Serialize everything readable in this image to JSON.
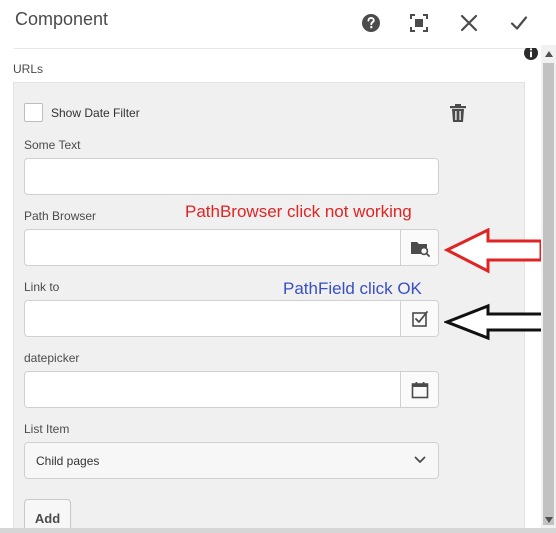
{
  "dialog": {
    "title": "Component",
    "help_tooltip": "Help",
    "fullscreen_tooltip": "Toggle Fullscreen",
    "cancel_tooltip": "Cancel",
    "done_tooltip": "Done"
  },
  "section": {
    "label": "URLs"
  },
  "item": {
    "checkbox_label": "Show Date Filter",
    "checkbox_checked": false,
    "fields": {
      "some_text": {
        "label": "Some Text",
        "value": ""
      },
      "path_browser": {
        "label": "Path Browser",
        "value": ""
      },
      "link_to": {
        "label": "Link to",
        "value": ""
      },
      "datepicker": {
        "label": "datepicker",
        "value": ""
      },
      "list_item": {
        "label": "List Item",
        "value": "Child pages"
      }
    }
  },
  "add_button": {
    "label": "Add"
  },
  "annotations": {
    "red": {
      "text": "PathBrowser click not working",
      "color": "#e02424"
    },
    "blue": {
      "text": "PathField click OK",
      "color": "#3a4fc2"
    }
  },
  "icons": {
    "help": "help-circle-icon",
    "fullscreen": "fullscreen-icon",
    "close": "close-icon",
    "done": "checkmark-icon",
    "info": "info-icon",
    "delete": "trash-icon",
    "path_browser": "folder-search-icon",
    "path_field": "checkbox-select-icon",
    "calendar": "calendar-icon",
    "dropdown": "chevron-down-icon"
  }
}
